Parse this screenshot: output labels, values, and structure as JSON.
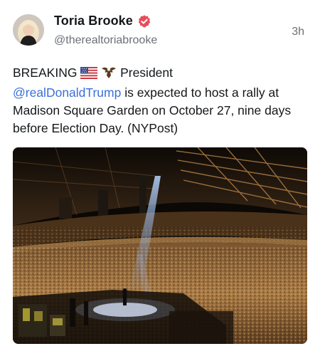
{
  "author": {
    "display_name": "Toria Brooke",
    "handle": "@therealtoriabrooke",
    "verified_badge": "verified-check-icon",
    "badge_color": "#e84d5b"
  },
  "post": {
    "timestamp": "3h",
    "text_lead": "BREAKING",
    "text_after_emoji": " President",
    "mention": "@realDonaldTrump",
    "text_rest": " is expected to host a rally at Madison Square Garden on October 27, nine days before Election Day. (NYPost)",
    "emojis": [
      "us-flag-icon",
      "eagle-icon"
    ],
    "mention_color": "#3a6fd8"
  },
  "media": {
    "type": "photo",
    "icon": "arena-rally-photo"
  }
}
